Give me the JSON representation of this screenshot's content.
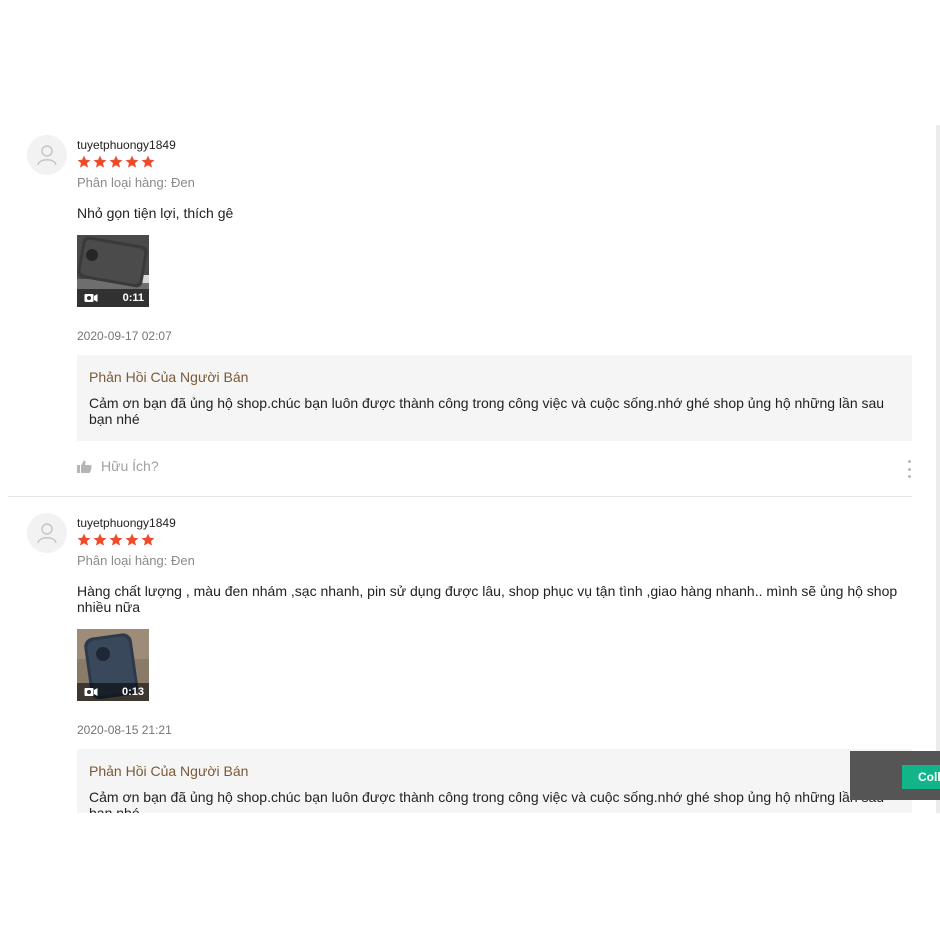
{
  "star_color": "#ee4d2d",
  "reply_title_color": "#7a5a36",
  "reviews": [
    {
      "username": "tuyetphuongy1849",
      "rating": 5,
      "variant": "Phân loại hàng: Đen",
      "comment": "Nhỏ gọn tiện lợi, thích gê",
      "video_duration": "0:11",
      "timestamp": "2020-09-17 02:07",
      "reply_title": "Phản Hồi Của Người Bán",
      "reply_text": "Cảm ơn bạn đã ủng hộ shop.chúc bạn luôn được thành công trong công việc và cuộc sống.nhớ ghé shop ủng hộ những lần sau bạn nhé",
      "helpful_label": "Hữu Ích?"
    },
    {
      "username": "tuyetphuongy1849",
      "rating": 5,
      "variant": "Phân loại hàng: Đen",
      "comment": "Hàng chất lượng , màu  đen nhám ,sạc nhanh, pin sử dụng được lâu, shop phục vụ tận tình ,giao hàng nhanh.. mình sẽ ủng hộ shop nhiều nữa",
      "video_duration": "0:13",
      "timestamp": "2020-08-15 21:21",
      "reply_title": "Phản Hồi Của Người Bán",
      "reply_text": "Cảm ơn bạn đã ủng hộ shop.chúc bạn luôn được thành công trong công việc và cuộc sống.nhớ ghé shop ủng hộ những lần sau bạn nhé"
    }
  ],
  "collect_button_label": "Collect"
}
